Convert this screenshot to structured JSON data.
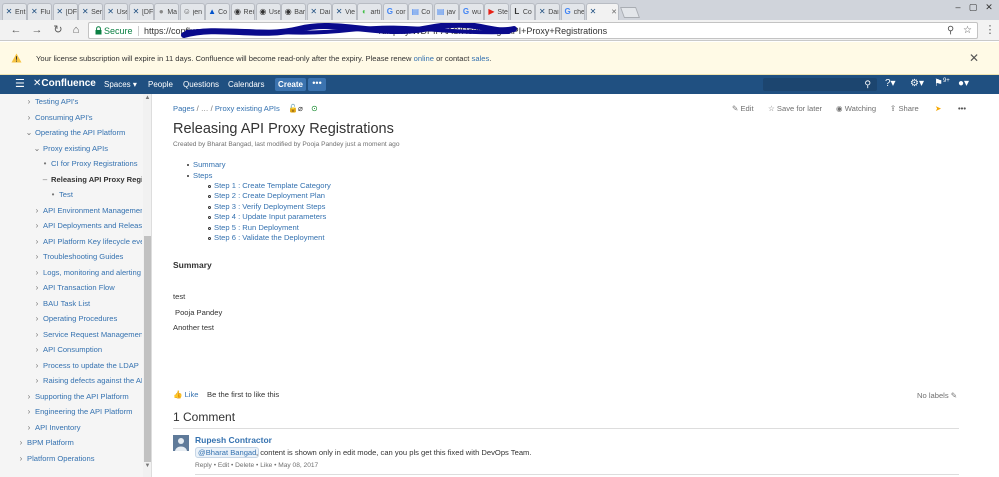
{
  "colors": {
    "confluence_header": "#205081",
    "link": "#3572b0",
    "secure": "#0b8043",
    "banner_bg": "#fffae6"
  },
  "browser": {
    "tabs": [
      {
        "title": "Ent",
        "icon": "confluence-icon"
      },
      {
        "title": "Flu",
        "icon": "confluence-icon"
      },
      {
        "title": "[DF",
        "icon": "confluence-icon"
      },
      {
        "title": "Ser",
        "icon": "confluence-icon"
      },
      {
        "title": "Use",
        "icon": "confluence-icon"
      },
      {
        "title": "[DF",
        "icon": "confluence-icon"
      },
      {
        "title": "Ma",
        "icon": "avatar-icon"
      },
      {
        "title": "jen",
        "icon": "jenkins-icon"
      },
      {
        "title": "Co",
        "icon": "atlassian-icon"
      },
      {
        "title": "Rei",
        "icon": "github-icon"
      },
      {
        "title": "Use",
        "icon": "github-icon"
      },
      {
        "title": "Bar",
        "icon": "github-icon"
      },
      {
        "title": "Dai",
        "icon": "confluence-icon"
      },
      {
        "title": "Vie",
        "icon": "confluence-icon"
      },
      {
        "title": "arti",
        "icon": "artifactory-icon"
      },
      {
        "title": "cor",
        "icon": "google-icon"
      },
      {
        "title": "Co",
        "icon": "page-icon"
      },
      {
        "title": "jav",
        "icon": "page-icon"
      },
      {
        "title": "wu",
        "icon": "google-icon"
      },
      {
        "title": "Ste",
        "icon": "youtube-icon"
      },
      {
        "title": "Co",
        "icon": "ls-icon"
      },
      {
        "title": "Dai",
        "icon": "confluence-icon"
      },
      {
        "title": "che",
        "icon": "google-icon"
      },
      {
        "title": "",
        "icon": "confluence-icon"
      }
    ],
    "url_visible": "https://confluence",
    "url_tail": "/display/WDPIPAAS/Releasing+API+Proxy+Registrations",
    "secure_label": "Secure"
  },
  "banner": {
    "text_before": "Your license subscription will expire in 11 days. Confluence will become read-only after the expiry. Please renew",
    "link_online": "online",
    "text_mid": "or contact",
    "link_sales": "sales",
    "text_end": "."
  },
  "header": {
    "logo": "Confluence",
    "nav": [
      "Spaces ▾",
      "People",
      "Questions",
      "Calendars"
    ],
    "create": "Create",
    "more": "•••",
    "notif_count": "9+"
  },
  "sidebar": {
    "items": [
      {
        "label": "Testing API's",
        "level": 1,
        "toggle": "›"
      },
      {
        "label": "Consuming API's",
        "level": 1,
        "toggle": "›"
      },
      {
        "label": "Operating the API Platform",
        "level": 1,
        "toggle": "⌄"
      },
      {
        "label": "Proxy existing APIs",
        "level": 2,
        "toggle": "⌄"
      },
      {
        "label": "CI for Proxy Registrations",
        "level": 3,
        "toggle": "•"
      },
      {
        "label": "Releasing API Proxy Registrations",
        "level": 3,
        "toggle": "–",
        "current": true
      },
      {
        "label": "Test",
        "level": 4,
        "toggle": "•"
      },
      {
        "label": "API Environment Management",
        "level": 2,
        "toggle": "›"
      },
      {
        "label": "API Deployments and Releases",
        "level": 2,
        "toggle": "›"
      },
      {
        "label": "API Platform Key lifecycle events",
        "level": 2,
        "toggle": "›"
      },
      {
        "label": "Troubleshooting Guides",
        "level": 2,
        "toggle": "›"
      },
      {
        "label": "Logs, monitoring and alerting",
        "level": 2,
        "toggle": "›"
      },
      {
        "label": "API Transaction Flow",
        "level": 2,
        "toggle": "›"
      },
      {
        "label": "BAU Task List",
        "level": 2,
        "toggle": "›"
      },
      {
        "label": "Operating Procedures",
        "level": 2,
        "toggle": "›"
      },
      {
        "label": "Service Request Management",
        "level": 2,
        "toggle": "›"
      },
      {
        "label": "API Consumption",
        "level": 2,
        "toggle": "›"
      },
      {
        "label": "Process to update the LDAP",
        "level": 2,
        "toggle": "›"
      },
      {
        "label": "Raising defects against the API",
        "level": 2,
        "toggle": "›"
      },
      {
        "label": "Supporting the API Platform",
        "level": 1,
        "toggle": "›"
      },
      {
        "label": "Engineering the API Platform",
        "level": 1,
        "toggle": "›"
      },
      {
        "label": "API Inventory",
        "level": 1,
        "toggle": "›"
      },
      {
        "label": "BPM Platform",
        "level": 0,
        "toggle": "›"
      },
      {
        "label": "Platform Operations",
        "level": 0,
        "toggle": "›"
      }
    ]
  },
  "page": {
    "breadcrumb_pages": "Pages",
    "breadcrumb_ellipsis": "/ … /",
    "breadcrumb_parent": "Proxy existing APIs",
    "actions": {
      "edit": "Edit",
      "save": "Save for later",
      "watching": "Watching",
      "share": "Share"
    },
    "title": "Releasing API Proxy Registrations",
    "byline": "Created by Bharat Bangad, last modified by Pooja Pandey just a moment ago",
    "toc": {
      "top": [
        "Summary",
        "Steps"
      ],
      "steps": [
        "Step 1 : Create Template Category",
        "Step 2 : Create Deployment Plan",
        "Step 3 : Verify Deployment Steps",
        "Step 4 : Update Input parameters",
        "Step 5 : Run Deployment",
        "Step 6 :  Validate the Deployment"
      ]
    },
    "summary_heading": "Summary",
    "body": [
      "test",
      "Pooja Pandey",
      "Another test"
    ],
    "like_link": "Like",
    "like_first": "Be the first to like this",
    "no_labels": "No labels",
    "comments_heading": "1 Comment",
    "comment": {
      "author": "Rupesh Contractor",
      "mention": "Bharat Bangad",
      "text": ", content is shown only in edit mode, can you pls get this fixed with DevOps Team.",
      "actions": "Reply • Edit • Delete • Like • May 08, 2017"
    }
  }
}
